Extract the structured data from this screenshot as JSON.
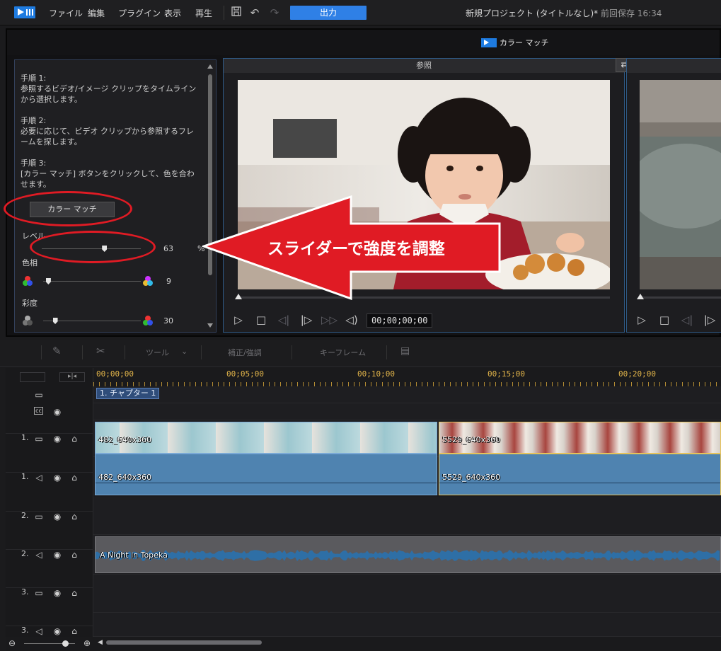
{
  "menubar": {
    "items": [
      "ファイル",
      "編集",
      "プラグイン",
      "表示",
      "再生"
    ],
    "output_label": "出力",
    "project_title": "新規プロジェクト (タイトルなし)*",
    "saved_time": "前回保存 16:34"
  },
  "color_match": {
    "title": "カラー マッチ",
    "steps": [
      {
        "heading": "手順 1:",
        "body": "参照するビデオ/イメージ クリップをタイムラインから選択します。"
      },
      {
        "heading": "手順 2:",
        "body": "必要に応じて、ビデオ クリップから参照するフレームを探します。"
      },
      {
        "heading": "手順 3:",
        "body": "[カラー マッチ] ボタンをクリックして、色を合わせます。"
      }
    ],
    "button_label": "カラー マッチ",
    "level": {
      "label": "レベル",
      "value": "63",
      "unit": "%",
      "fraction": 0.63
    },
    "hue": {
      "label": "色相",
      "value": "9",
      "fraction": 0.05
    },
    "saturation": {
      "label": "彩度",
      "value": "30",
      "fraction": 0.12
    },
    "reference_label": "参照",
    "timecode": "00;00;00;00"
  },
  "annotation": {
    "text": "スライダーで強度を調整",
    "color": "#e01b24"
  },
  "edit_toolbar": {
    "tools_label": "ツール",
    "fix_label": "補正/強調",
    "keyframe_label": "キーフレーム"
  },
  "timeline": {
    "ruler_labels": [
      "00;00;00",
      "00;05;00",
      "00;10;00",
      "00;15;00",
      "00;20;00"
    ],
    "chapter": "1. チャプター 1",
    "tracks": [
      {
        "num": "1.",
        "kind": "video"
      },
      {
        "num": "1.",
        "kind": "audio"
      },
      {
        "num": "2.",
        "kind": "video"
      },
      {
        "num": "2.",
        "kind": "audio"
      },
      {
        "num": "3.",
        "kind": "video"
      },
      {
        "num": "3.",
        "kind": "audio"
      }
    ],
    "clip1_name": "482_640x360",
    "clip2_name": "5529_640x360",
    "music_name": "A Night in Topeka"
  }
}
